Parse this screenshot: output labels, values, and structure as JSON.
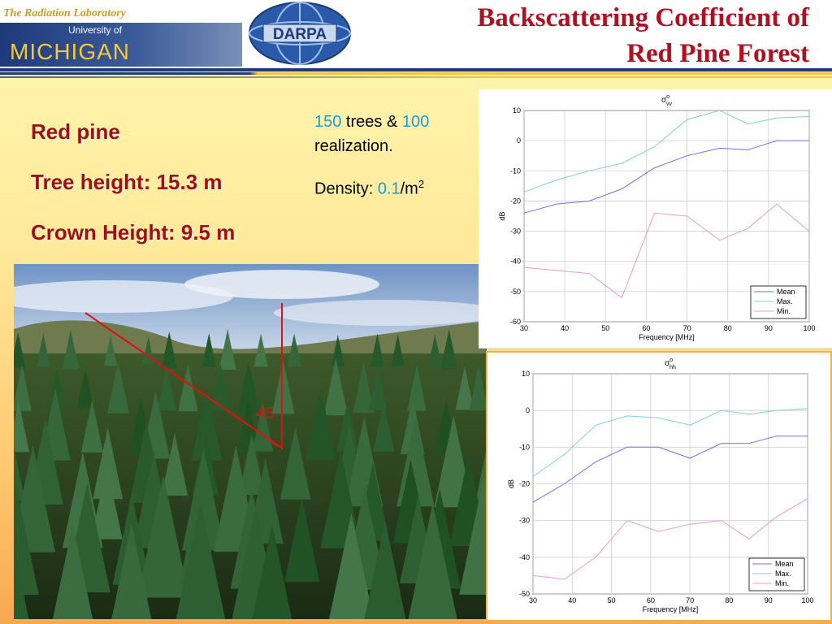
{
  "header": {
    "lab_name": "The Radiation Laboratory",
    "university_of": "University of",
    "michigan": "MICHIGAN",
    "darpa": "DARPA",
    "title_line1": "Backscattering Coefficient of",
    "title_line2": "Red Pine Forest"
  },
  "specs": {
    "species": "Red pine",
    "tree_height": "Tree height: 15.3 m",
    "crown_height": "Crown Height: 9.5 m"
  },
  "info": {
    "trees_count": "150",
    "trees_text": " trees & ",
    "realizations_count": "100",
    "realization_text": "realization.",
    "density_label": "Density: ",
    "density_value": "0.1",
    "density_unit": "/m",
    "density_exp": "2"
  },
  "photo": {
    "angle_label": "45"
  },
  "colors": {
    "title": "#b01020",
    "spec_text": "#a01010",
    "highlight_blue": "#1e9ad6",
    "mean_line": "#6f6fe8",
    "max_line": "#7fd0d8",
    "min_line": "#e89ad8"
  },
  "chart_data": [
    {
      "id": "vv",
      "type": "line",
      "title_symbol": "σ",
      "title_sup": "o",
      "title_sub": "vv",
      "xlabel": "Frequency [MHz]",
      "ylabel": "dB",
      "xlim": [
        30,
        100
      ],
      "ylim": [
        -60,
        10
      ],
      "xticks": [
        30,
        40,
        50,
        60,
        70,
        80,
        90,
        100
      ],
      "yticks": [
        10,
        0,
        -10,
        -20,
        -30,
        -40,
        -50,
        -60
      ],
      "grid": true,
      "legend_position": "bottom-right",
      "series": [
        {
          "name": "Mean",
          "x": [
            30,
            38,
            46,
            54,
            62,
            70,
            78,
            85,
            92,
            100
          ],
          "y": [
            -24,
            -21,
            -20,
            -16,
            -9,
            -5,
            -2.5,
            -3,
            0,
            0
          ]
        },
        {
          "name": "Max.",
          "x": [
            30,
            38,
            46,
            54,
            62,
            70,
            78,
            85,
            92,
            100
          ],
          "y": [
            -17,
            -13,
            -10,
            -7.5,
            -2,
            7,
            10,
            5.5,
            7.5,
            8
          ]
        },
        {
          "name": "Min.",
          "x": [
            30,
            38,
            46,
            54,
            62,
            70,
            78,
            85,
            92,
            100
          ],
          "y": [
            -42,
            -43,
            -44,
            -52,
            -24,
            -25,
            -33,
            -29,
            -21,
            -30
          ]
        }
      ]
    },
    {
      "id": "hh",
      "type": "line",
      "title_symbol": "σ",
      "title_sup": "o",
      "title_sub": "hh",
      "xlabel": "Frequency [MHz]",
      "ylabel": "dB",
      "xlim": [
        30,
        100
      ],
      "ylim": [
        -50,
        10
      ],
      "xticks": [
        30,
        40,
        50,
        60,
        70,
        80,
        90,
        100
      ],
      "yticks": [
        10,
        0,
        -10,
        -20,
        -30,
        -40,
        -50
      ],
      "grid": true,
      "legend_position": "bottom-right",
      "series": [
        {
          "name": "Mean",
          "x": [
            30,
            38,
            46,
            54,
            62,
            70,
            78,
            85,
            92,
            100
          ],
          "y": [
            -25,
            -20,
            -14,
            -10,
            -10,
            -13,
            -9,
            -9,
            -7,
            -7
          ]
        },
        {
          "name": "Max.",
          "x": [
            30,
            38,
            46,
            54,
            62,
            70,
            78,
            85,
            92,
            100
          ],
          "y": [
            -18,
            -12,
            -4,
            -1.5,
            -2,
            -4,
            0,
            -1,
            0,
            0.5
          ]
        },
        {
          "name": "Min.",
          "x": [
            30,
            38,
            46,
            54,
            62,
            70,
            78,
            85,
            92,
            100
          ],
          "y": [
            -45,
            -46,
            -40,
            -30,
            -33,
            -31,
            -30,
            -35,
            -29,
            -24
          ]
        }
      ]
    }
  ]
}
